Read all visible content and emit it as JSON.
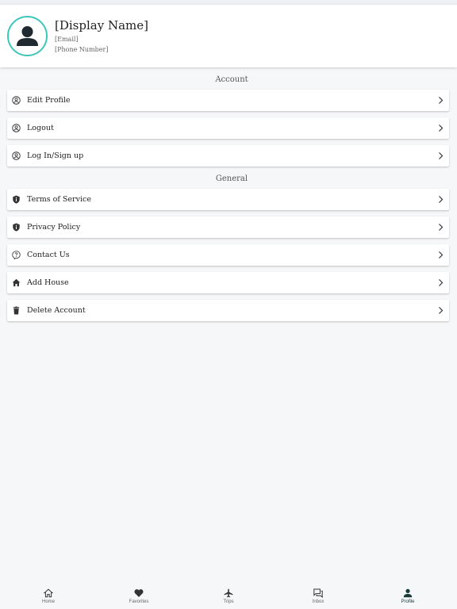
{
  "profile": {
    "display_name": "[Display Name]",
    "email": "[Email]",
    "phone": "[Phone Number]"
  },
  "sections": {
    "account_label": "Account",
    "general_label": "General"
  },
  "account_items": [
    {
      "label": "Edit Profile",
      "icon": "user-circle-icon"
    },
    {
      "label": "Logout",
      "icon": "user-circle-icon"
    },
    {
      "label": "Log In/Sign up",
      "icon": "user-circle-icon"
    }
  ],
  "general_items": [
    {
      "label": "Terms of Service",
      "icon": "shield-info-icon"
    },
    {
      "label": "Privacy Policy",
      "icon": "shield-info-icon"
    },
    {
      "label": "Contact Us",
      "icon": "question-bubble-icon"
    },
    {
      "label": "Add House",
      "icon": "home-icon"
    },
    {
      "label": "Delete Account",
      "icon": "trash-icon"
    }
  ],
  "bottom_nav": [
    {
      "label": "Home",
      "icon": "home-icon"
    },
    {
      "label": "Favorites",
      "icon": "heart-icon"
    },
    {
      "label": "Trips",
      "icon": "airplane-icon"
    },
    {
      "label": "Inbox",
      "icon": "chat-bubbles-icon"
    },
    {
      "label": "Profile",
      "icon": "person-icon",
      "active": true
    }
  ],
  "colors": {
    "accent_ring": "#3fc6bb",
    "background": "#f6f7f9",
    "active_nav": "#1b3a3a"
  }
}
